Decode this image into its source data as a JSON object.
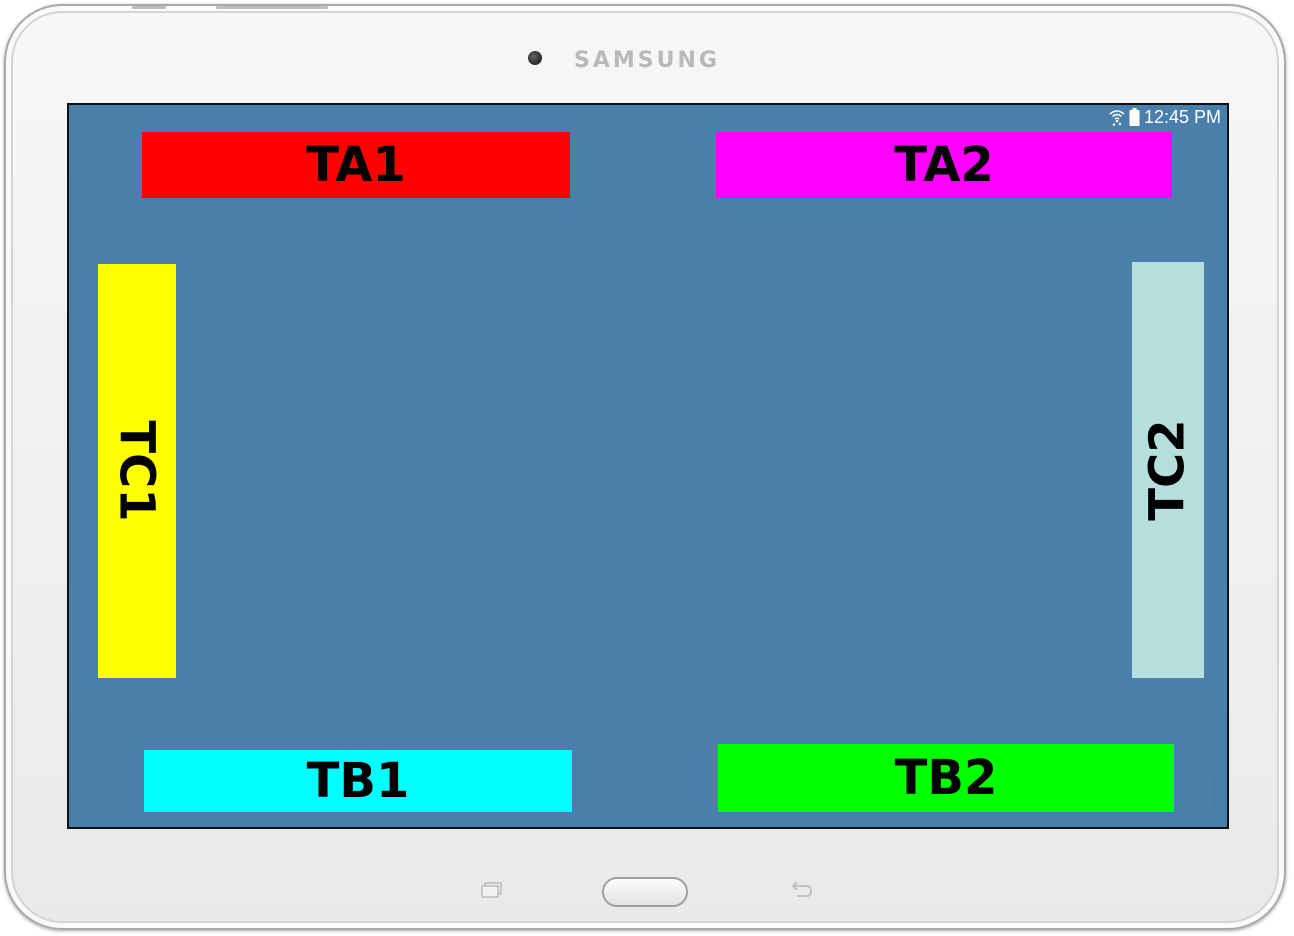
{
  "device": {
    "brand": "SAMSUNG",
    "icons": {
      "camera": "front-camera-icon",
      "recent_apps": "recent-apps-icon",
      "home": "home-button-icon",
      "back": "back-arrow-icon"
    }
  },
  "status_bar": {
    "time": "12:45 PM",
    "icons": [
      "wifi-icon",
      "battery-icon"
    ]
  },
  "screen": {
    "background": "#4a7fac",
    "blocks": [
      {
        "id": "ta1",
        "label": "TA1",
        "color": "#ff0000",
        "orientation": "horizontal"
      },
      {
        "id": "ta2",
        "label": "TA2",
        "color": "#ff00ff",
        "orientation": "horizontal"
      },
      {
        "id": "tc1",
        "label": "TC1",
        "color": "#ffff00",
        "orientation": "rotated-clockwise"
      },
      {
        "id": "tc2",
        "label": "TC2",
        "color": "#b5dfdd",
        "orientation": "rotated-counterclockwise"
      },
      {
        "id": "tb1",
        "label": "TB1",
        "color": "#00ffff",
        "orientation": "horizontal"
      },
      {
        "id": "tb2",
        "label": "TB2",
        "color": "#00ff00",
        "orientation": "horizontal"
      }
    ]
  }
}
